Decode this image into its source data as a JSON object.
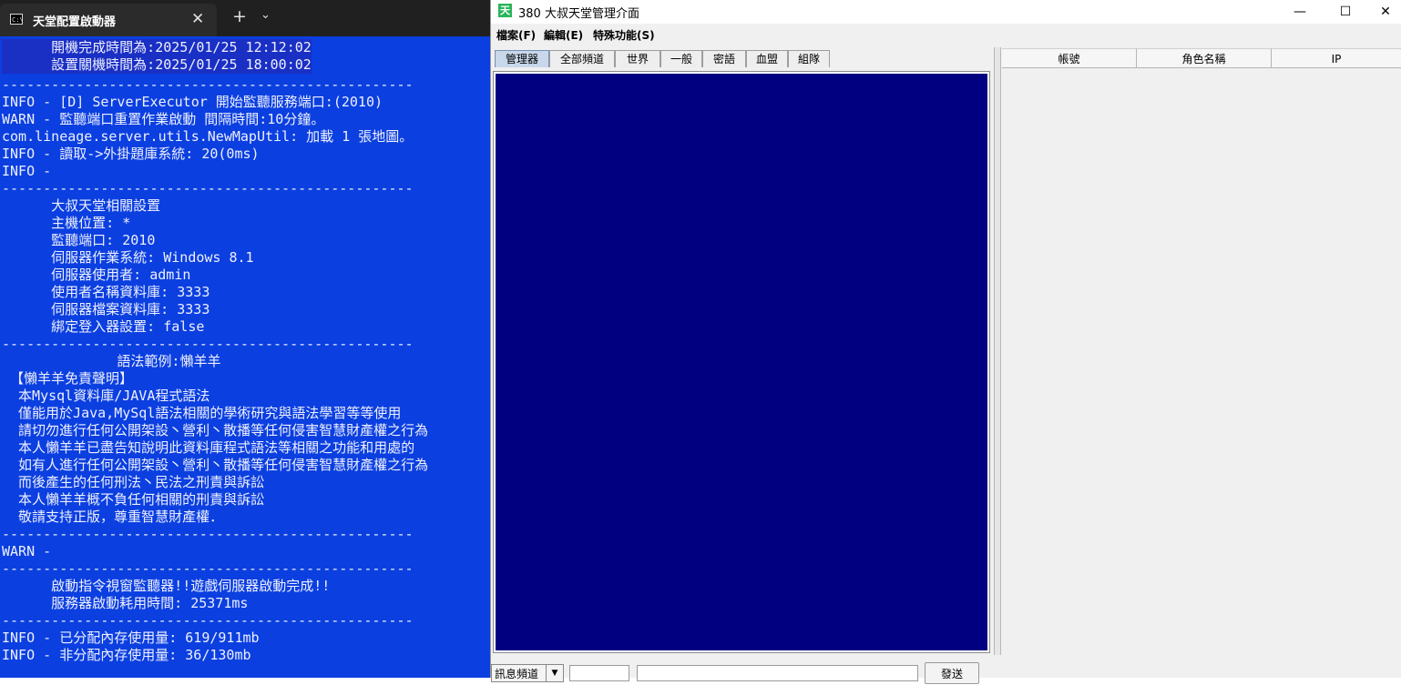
{
  "terminal": {
    "tab_title": "天堂配置啟動器",
    "tab_icon_text": "C:\\",
    "close_glyph": "✕",
    "new_tab_glyph": "+",
    "dropdown_glyph": "⌄",
    "lines": [
      "      開機完成時間為:2025/01/25 12:12:02",
      "      設置關機時間為:2025/01/25 18:00:02",
      "--------------------------------------------------",
      "INFO - [D] ServerExecutor 開始監聽服務端口:(2010)",
      "WARN - 監聽端口重置作業啟動 間隔時間:10分鐘。",
      "com.lineage.server.utils.NewMapUtil: 加載 1 張地圖。",
      "INFO - 讀取->外掛題庫系統: 20(0ms)",
      "INFO -",
      "--------------------------------------------------",
      "      大叔天堂相關設置",
      "      主機位置: *",
      "      監聽端口: 2010",
      "      伺服器作業系統: Windows 8.1",
      "      伺服器使用者: admin",
      "      使用者名稱資料庫: 3333",
      "      伺服器檔案資料庫: 3333",
      "      綁定登入器設置: false",
      "--------------------------------------------------",
      "              語法範例:懶羊羊",
      " 【懶羊羊免責聲明】",
      "  本Mysql資料庫/JAVA程式語法",
      "  僅能用於Java,MySql語法相關的學術研究與語法學習等等使用",
      "  請切勿進行任何公開架設丶營利丶散播等任何侵害智慧財產權之行為",
      "  本人懶羊羊已盡告知說明此資料庫程式語法等相關之功能和用處的",
      "  如有人進行任何公開架設丶營利丶散播等任何侵害智慧財產權之行為",
      "  而後產生的任何刑法丶民法之刑責與訴訟",
      "  本人懶羊羊概不負任何相關的刑責與訴訟",
      "  敬請支持正版，尊重智慧財產權．",
      "--------------------------------------------------",
      "WARN -",
      "--------------------------------------------------",
      "      啟動指令視窗監聽器!!遊戲伺服器啟動完成!!",
      "      服務器啟動耗用時間: 25371ms",
      "--------------------------------------------------",
      "INFO - 已分配內存使用量: 619/911mb",
      "INFO - 非分配內存使用量: 36/130mb"
    ]
  },
  "manager": {
    "icon_text": "天",
    "title": "380 大叔天堂管理介面",
    "window_buttons": {
      "minimize": "—",
      "maximize": "☐",
      "close": "✕"
    },
    "menu": {
      "file": "檔案(F)",
      "edit": "編輯(E)",
      "special": "特殊功能(S)"
    },
    "tabs": [
      "管理器",
      "全部頻道",
      "世界",
      "一般",
      "密語",
      "血盟",
      "組隊"
    ],
    "active_tab": "管理器",
    "table_headers": [
      "帳號",
      "角色名稱",
      "IP"
    ],
    "channel_select": {
      "label": "訊息頻道",
      "arrow": "▼"
    },
    "send_label": "發送",
    "colors": {
      "chat_background": "#000080",
      "terminal_background": "#0b3fe0"
    }
  }
}
